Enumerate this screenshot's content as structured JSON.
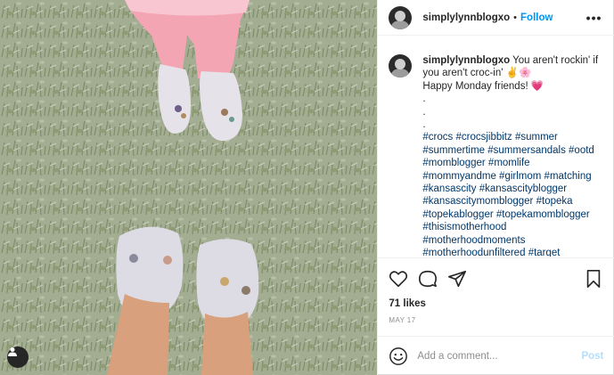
{
  "header": {
    "username": "simplylynnblogxo",
    "separator": "•",
    "follow_label": "Follow",
    "more_label": "•••"
  },
  "caption": {
    "username": "simplylynnblogxo",
    "line1": "You aren't rockin' if you aren't croc-in' ✌️🌸",
    "line2": "Happy Monday friends! ",
    "heart": "💗",
    "dots": [
      ".",
      ".",
      "."
    ],
    "hashtags": [
      "#crocs",
      "#crocsjibbitz",
      "#summer",
      "#summertime",
      "#summersandals",
      "#ootd",
      "#momblogger",
      "#momlife",
      "#mommyandme",
      "#girlmom",
      "#matching",
      "#kansascity",
      "#kansascityblogger",
      "#kansascitymomblogger",
      "#topeka",
      "#topekablogger",
      "#topekamomblogger",
      "#thisismotherhood",
      "#motherhoodmoments",
      "#motherhoodunfiltered",
      "#target"
    ]
  },
  "actions": {
    "icons": [
      "heart-outline-icon",
      "comment-icon",
      "share-icon",
      "bookmark-icon"
    ]
  },
  "likes_text": "71 likes",
  "date_text": "MAY 17",
  "add_comment": {
    "placeholder": "Add a comment...",
    "post_label": "Post"
  },
  "colors": {
    "follow": "#0095f6",
    "hashtag": "#00376b",
    "post_disabled": "#b2dffc",
    "muted": "#8e8e8e"
  }
}
